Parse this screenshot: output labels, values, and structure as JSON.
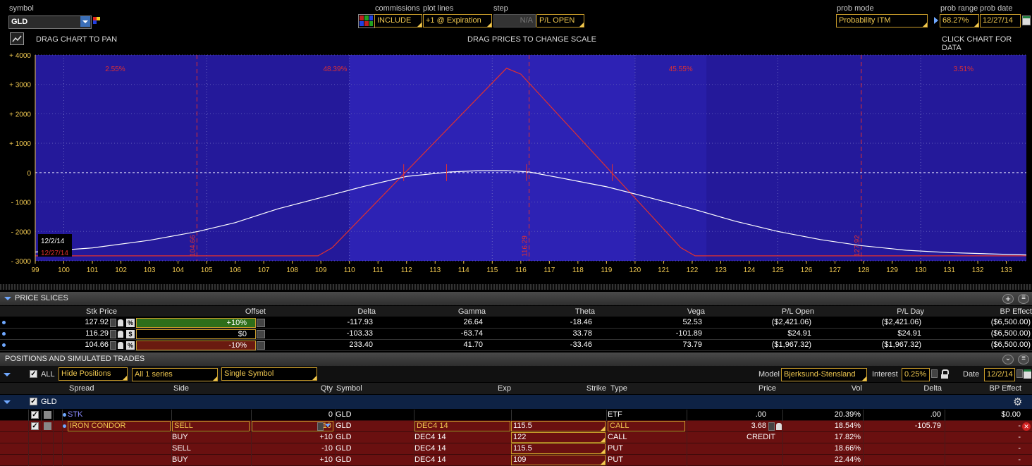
{
  "toolbar": {
    "symbol_label": "symbol",
    "symbol_value": "GLD",
    "commissions_label": "commissions",
    "commissions_value": "INCLUDE",
    "plot_lines_label": "plot lines",
    "plot_lines_value": "+1 @ Expiration",
    "step_label": "step",
    "step_value": "N/A",
    "pl_mode": "P/L OPEN",
    "prob_mode_label": "prob mode",
    "prob_mode_value": "Probability ITM",
    "prob_range_label": "prob range",
    "prob_range_value": "68.27%",
    "prob_date_label": "prob date",
    "prob_date_value": "12/27/14"
  },
  "hints": {
    "drag_pan": "DRAG CHART TO PAN",
    "drag_scale": "DRAG PRICES TO CHANGE SCALE",
    "click_data": "CLICK CHART FOR DATA"
  },
  "chart_data": {
    "type": "line",
    "x_ticks": [
      "99",
      "100",
      "101",
      "102",
      "103",
      "104",
      "105",
      "106",
      "107",
      "108",
      "109",
      "110",
      "111",
      "112",
      "113",
      "114",
      "115",
      "116",
      "117",
      "118",
      "119",
      "120",
      "121",
      "122",
      "123",
      "124",
      "125",
      "126",
      "127",
      "128",
      "129",
      "130",
      "131",
      "132",
      "133"
    ],
    "y_ticks": [
      "+ 4000",
      "+ 3000",
      "+ 2000",
      "+ 1000",
      "0",
      "- 1000",
      "- 2000",
      "- 3000"
    ],
    "xlim": [
      99,
      133.7
    ],
    "ylim": [
      -3000,
      4000
    ],
    "series": [
      {
        "name": "12/27/14",
        "color": "#e03030",
        "x": [
          99,
          108.9,
          109.4,
          115.5,
          116.0,
          121.6,
          122.1,
          133.7
        ],
        "y": [
          -2830,
          -2830,
          -2550,
          3550,
          3350,
          -2550,
          -2830,
          -2830
        ]
      },
      {
        "name": "12/2/14",
        "color": "#ffffff",
        "x": [
          99,
          101,
          103,
          104.7,
          106,
          107.5,
          109,
          110.5,
          112,
          113.5,
          114.5,
          115.5,
          116.3,
          117.5,
          119,
          120.5,
          122,
          123.5,
          125,
          126.5,
          127.9,
          129.5,
          131,
          133.7
        ],
        "y": [
          -2700,
          -2560,
          -2300,
          -2000,
          -1700,
          -1230,
          -850,
          -470,
          -130,
          20,
          65,
          70,
          20,
          -200,
          -480,
          -850,
          -1230,
          -1650,
          -2000,
          -2280,
          -2480,
          -2640,
          -2720,
          -2800
        ]
      }
    ],
    "price_lines": [
      {
        "x": 104.66,
        "label": "104.66"
      },
      {
        "x": 116.29,
        "label": "116.29"
      },
      {
        "x": 127.92,
        "label": "127.92"
      }
    ],
    "break_marks_x": [
      111.9,
      113.4,
      116.2,
      119.2
    ],
    "probabilities": [
      {
        "x": 101.8,
        "label": "2.55%"
      },
      {
        "x": 109.5,
        "label": "48.39%"
      },
      {
        "x": 121.6,
        "label": "45.55%"
      },
      {
        "x": 131.5,
        "label": "3.51%"
      }
    ],
    "legend": [
      "12/2/14",
      "12/27/14"
    ],
    "grid": true
  },
  "price_slices": {
    "title": "PRICE SLICES",
    "columns": [
      "Stk Price",
      "Offset",
      "Delta",
      "Gamma",
      "Theta",
      "Vega",
      "P/L Open",
      "P/L Day",
      "BP Effect"
    ],
    "rows": [
      {
        "stk": "127.92",
        "unit": "%",
        "offset": "+10%",
        "delta": "-117.93",
        "gamma": "26.64",
        "theta": "-18.46",
        "vega": "52.53",
        "pl_open": "($2,421.06)",
        "pl_day": "($2,421.06)",
        "bp": "($6,500.00)",
        "color": "#2e6e1a"
      },
      {
        "stk": "116.29",
        "unit": "$",
        "offset": "$0",
        "delta": "-103.33",
        "gamma": "-63.74",
        "theta": "33.78",
        "vega": "-101.89",
        "pl_open": "$24.91",
        "pl_day": "$24.91",
        "bp": "($6,500.00)",
        "color": "#000000"
      },
      {
        "stk": "104.66",
        "unit": "%",
        "offset": "-10%",
        "delta": "233.40",
        "gamma": "41.70",
        "theta": "-33.46",
        "vega": "73.79",
        "pl_open": "($1,967.32)",
        "pl_day": "($1,967.32)",
        "bp": "($6,500.00)",
        "color": "#6a1a10"
      }
    ]
  },
  "positions": {
    "title": "POSITIONS AND SIMULATED TRADES",
    "all_label": "ALL",
    "hide_positions": "Hide Positions",
    "series": "All 1 series",
    "symbol_mode": "Single Symbol",
    "model_label": "Model",
    "model_value": "Bjerksund-Stensland",
    "interest_label": "Interest",
    "interest_value": "0.25%",
    "date_label": "Date",
    "date_value": "12/2/14",
    "columns": [
      "Spread",
      "Side",
      "Qty",
      "Symbol",
      "Exp",
      "Strike",
      "Type",
      "Price",
      "Vol",
      "Delta",
      "BP Effect"
    ],
    "group": "GLD",
    "rows": [
      {
        "spread": "STK",
        "side": "",
        "qty": "0",
        "symbol": "GLD",
        "exp": "",
        "strike": "",
        "type": "ETF",
        "price": ".00",
        "vol": "20.39%",
        "delta": ".00",
        "bp": "$0.00"
      },
      {
        "spread": "IRON CONDOR",
        "side": "SELL",
        "qty": "-10",
        "symbol": "GLD",
        "exp": "DEC4 14",
        "strike": "115.5",
        "type": "CALL",
        "price": "3.68",
        "vol": "18.54%",
        "delta": "-105.79",
        "bp": "-"
      },
      {
        "spread": "",
        "side": "BUY",
        "qty": "+10",
        "symbol": "GLD",
        "exp": "DEC4 14",
        "strike": "122",
        "type": "CALL",
        "price": "CREDIT",
        "vol": "17.82%",
        "delta": "",
        "bp": "-"
      },
      {
        "spread": "",
        "side": "SELL",
        "qty": "-10",
        "symbol": "GLD",
        "exp": "DEC4 14",
        "strike": "115.5",
        "type": "PUT",
        "price": "",
        "vol": "18.66%",
        "delta": "",
        "bp": "-"
      },
      {
        "spread": "",
        "side": "BUY",
        "qty": "+10",
        "symbol": "GLD",
        "exp": "DEC4 14",
        "strike": "109",
        "type": "PUT",
        "price": "",
        "vol": "22.44%",
        "delta": "",
        "bp": "-"
      }
    ]
  }
}
